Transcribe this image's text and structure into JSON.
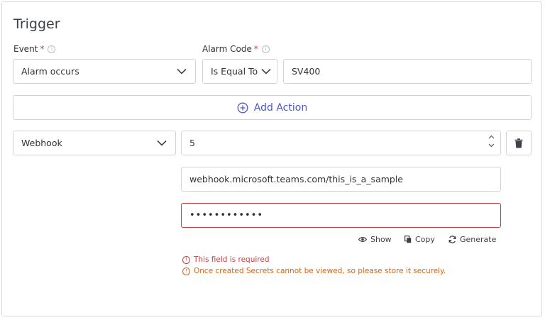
{
  "trigger": {
    "title": "Trigger",
    "event": {
      "label": "Event",
      "required_mark": "*",
      "value": "Alarm occurs"
    },
    "alarm_code": {
      "label": "Alarm Code",
      "required_mark": "*",
      "operator": "Is Equal To",
      "value": "SV400"
    }
  },
  "add_action": {
    "label": "Add Action"
  },
  "action": {
    "type": "Webhook",
    "number": "5",
    "url": "webhook.microsoft.teams.com/this_is_a_sample",
    "secret": "••••••••••••",
    "show_label": "Show",
    "copy_label": "Copy",
    "generate_label": "Generate",
    "error_required": "This field is required",
    "warning_secret": "Once created Secrets cannot be viewed, so please store it securely."
  },
  "colors": {
    "accent": "#4a57c9",
    "error": "#d93737",
    "warning": "#d9640f"
  }
}
